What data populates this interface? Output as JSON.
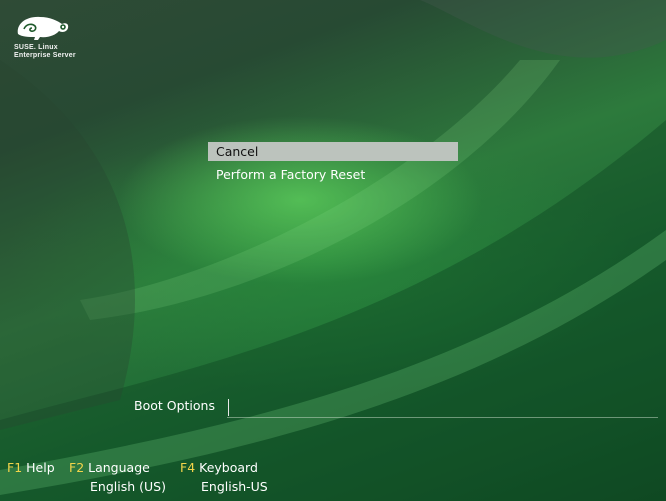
{
  "branding": {
    "line1": "SUSE. Linux",
    "line2": "Enterprise Server"
  },
  "menu": {
    "items": [
      {
        "label": "Cancel",
        "selected": true
      },
      {
        "label": "Perform a Factory Reset",
        "selected": false
      }
    ]
  },
  "boot_options": {
    "label": "Boot Options",
    "value": ""
  },
  "function_keys": [
    {
      "key": "F1",
      "label": "Help",
      "value": ""
    },
    {
      "key": "F2",
      "label": "Language",
      "value": "English (US)"
    },
    {
      "key": "F4",
      "label": "Keyboard",
      "value": "English-US"
    }
  ],
  "colors": {
    "function_key": "#f2d44a",
    "selection_bar": "#bcc3bd",
    "background": "#1f5a2c"
  },
  "icons": {
    "logo": "suse-chameleon-icon"
  }
}
